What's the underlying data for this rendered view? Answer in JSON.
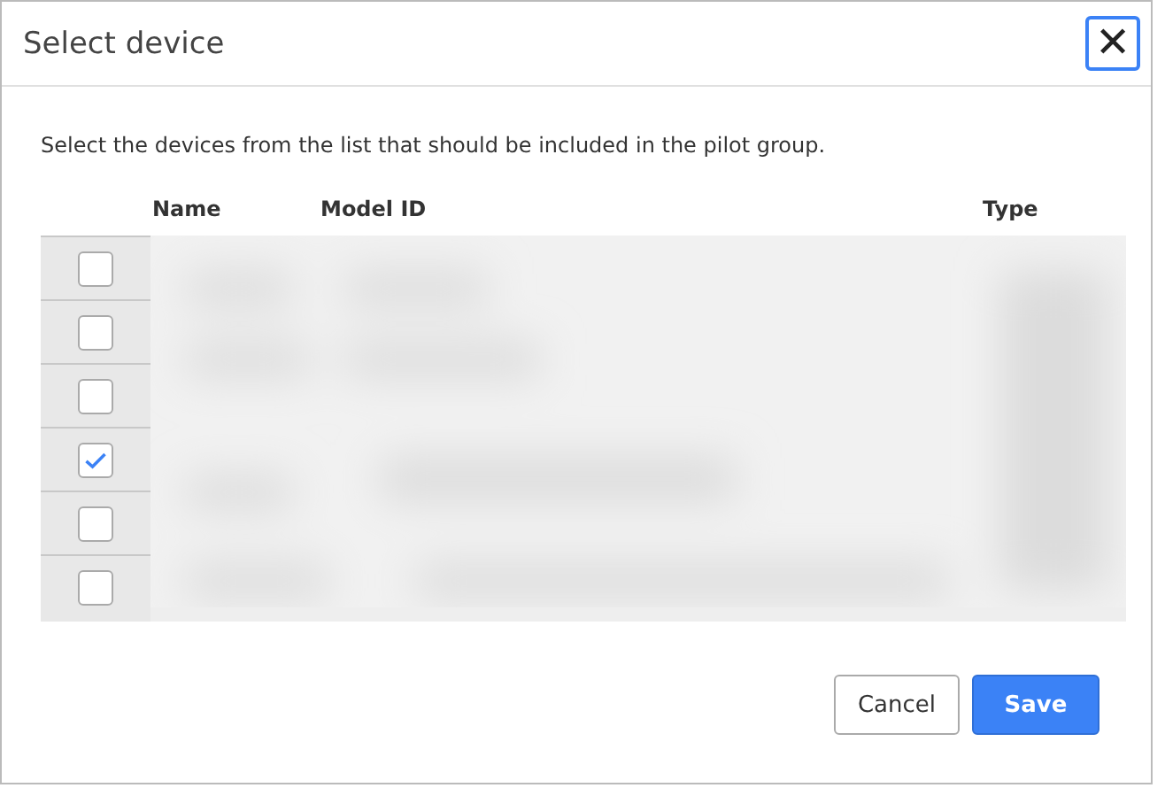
{
  "dialog": {
    "title": "Select device",
    "close": "✕"
  },
  "instructions": "Select the devices from the list that should be included in the pilot group.",
  "table": {
    "columns": [
      "Name",
      "Model ID",
      "Type"
    ],
    "rows": [
      {
        "checked": false
      },
      {
        "checked": false
      },
      {
        "checked": false
      },
      {
        "checked": true
      },
      {
        "checked": false
      },
      {
        "checked": false
      }
    ]
  },
  "buttons": [
    {
      "label": "Cancel",
      "kind": "secondary"
    },
    {
      "label": "Save",
      "kind": "primary"
    }
  ]
}
